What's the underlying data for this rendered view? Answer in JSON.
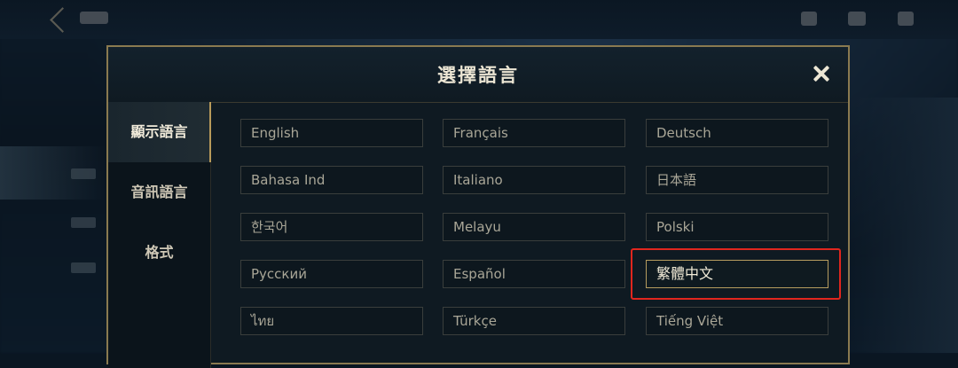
{
  "modal": {
    "title": "選擇語言",
    "close_icon": "close-icon"
  },
  "tabs": [
    {
      "label": "顯示語言",
      "active": true
    },
    {
      "label": "音訊語言",
      "active": false
    },
    {
      "label": "格式",
      "active": false
    }
  ],
  "languages": [
    {
      "label": "English"
    },
    {
      "label": "Français"
    },
    {
      "label": "Deutsch"
    },
    {
      "label": "Bahasa Ind"
    },
    {
      "label": "Italiano"
    },
    {
      "label": "日本語"
    },
    {
      "label": "한국어"
    },
    {
      "label": "Melayu"
    },
    {
      "label": "Polski"
    },
    {
      "label": "Русский"
    },
    {
      "label": "Español"
    },
    {
      "label": "繁體中文",
      "selected": true
    },
    {
      "label": "ไทย"
    },
    {
      "label": "Türkçe"
    },
    {
      "label": "Tiếng Việt"
    }
  ],
  "colors": {
    "accent_gold": "#b69c5f",
    "highlight_red": "#e0261e"
  }
}
